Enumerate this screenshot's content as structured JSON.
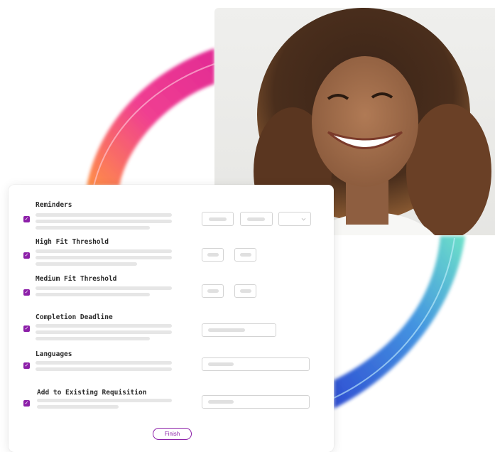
{
  "settings": {
    "rows": [
      {
        "label": "Reminders",
        "checked": true,
        "control": "triple-select"
      },
      {
        "label": "High Fit Threshold",
        "checked": true,
        "control": "double-box"
      },
      {
        "label": "Medium Fit Threshold",
        "checked": true,
        "control": "double-box"
      },
      {
        "label": "Completion Deadline",
        "checked": true,
        "control": "input"
      },
      {
        "label": "Languages",
        "checked": true,
        "control": "input-wide"
      },
      {
        "label": "Add to Existing Requisition",
        "checked": true,
        "control": "input-wide"
      }
    ],
    "checkmark": "✓",
    "finish_label": "Finish"
  },
  "colors": {
    "accent": "#8c1fa8",
    "ring_pink": "#f0358c",
    "ring_orange": "#ff6a3d",
    "ring_teal": "#5fd6c4",
    "ring_blue": "#2f5fd8"
  },
  "photo": {
    "subject": "smiling woman with curly hair"
  }
}
